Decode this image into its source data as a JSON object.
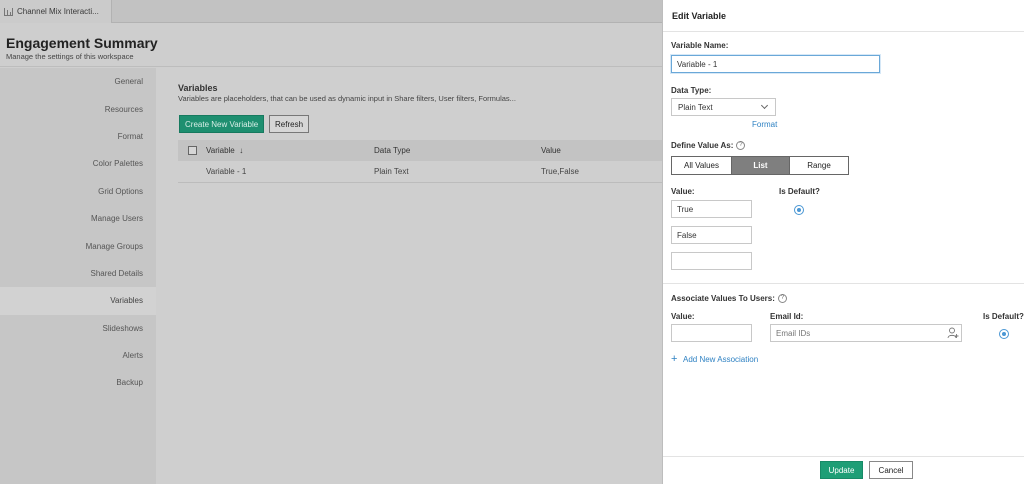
{
  "tab": {
    "label": "Channel Mix Interacti...",
    "icon": "bar-chart-icon"
  },
  "header": {
    "title": "Engagement Summary",
    "subtitle": "Manage the settings of this workspace"
  },
  "sidebar": {
    "items": [
      {
        "label": "General"
      },
      {
        "label": "Resources"
      },
      {
        "label": "Format"
      },
      {
        "label": "Color Palettes"
      },
      {
        "label": "Grid Options"
      },
      {
        "label": "Manage Users"
      },
      {
        "label": "Manage Groups"
      },
      {
        "label": "Shared Details"
      },
      {
        "label": "Variables",
        "active": true
      },
      {
        "label": "Slideshows"
      },
      {
        "label": "Alerts"
      },
      {
        "label": "Backup"
      }
    ]
  },
  "main": {
    "title": "Variables",
    "description": "Variables are placeholders, that can be used as dynamic input in Share filters, User filters, Formulas...",
    "create_label": "Create New Variable",
    "refresh_label": "Refresh",
    "columns": {
      "variable": "Variable",
      "sort_arrow": "↓",
      "data_type": "Data Type",
      "value": "Value"
    },
    "rows": [
      {
        "variable": "Variable - 1",
        "data_type": "Plain Text",
        "value": "True,False"
      }
    ]
  },
  "drawer": {
    "title": "Edit Variable",
    "name_label": "Variable Name:",
    "name_value": "Variable - 1",
    "type_label": "Data Type:",
    "type_value": "Plain Text",
    "format_link": "Format",
    "define_label": "Define Value As:",
    "help_glyph": "?",
    "define_options": [
      "All Values",
      "List",
      "Range"
    ],
    "define_selected": "List",
    "value_label": "Value:",
    "default_label": "Is Default?",
    "values": [
      "True",
      "False",
      ""
    ],
    "default_index": 0,
    "assoc_label": "Associate Values To Users:",
    "assoc_value_label": "Value:",
    "assoc_email_label": "Email Id:",
    "assoc_default_label": "Is Default?",
    "email_placeholder": "Email IDs",
    "add_assoc_label": "Add New Association",
    "add_glyph": "+",
    "update_label": "Update",
    "cancel_label": "Cancel"
  }
}
